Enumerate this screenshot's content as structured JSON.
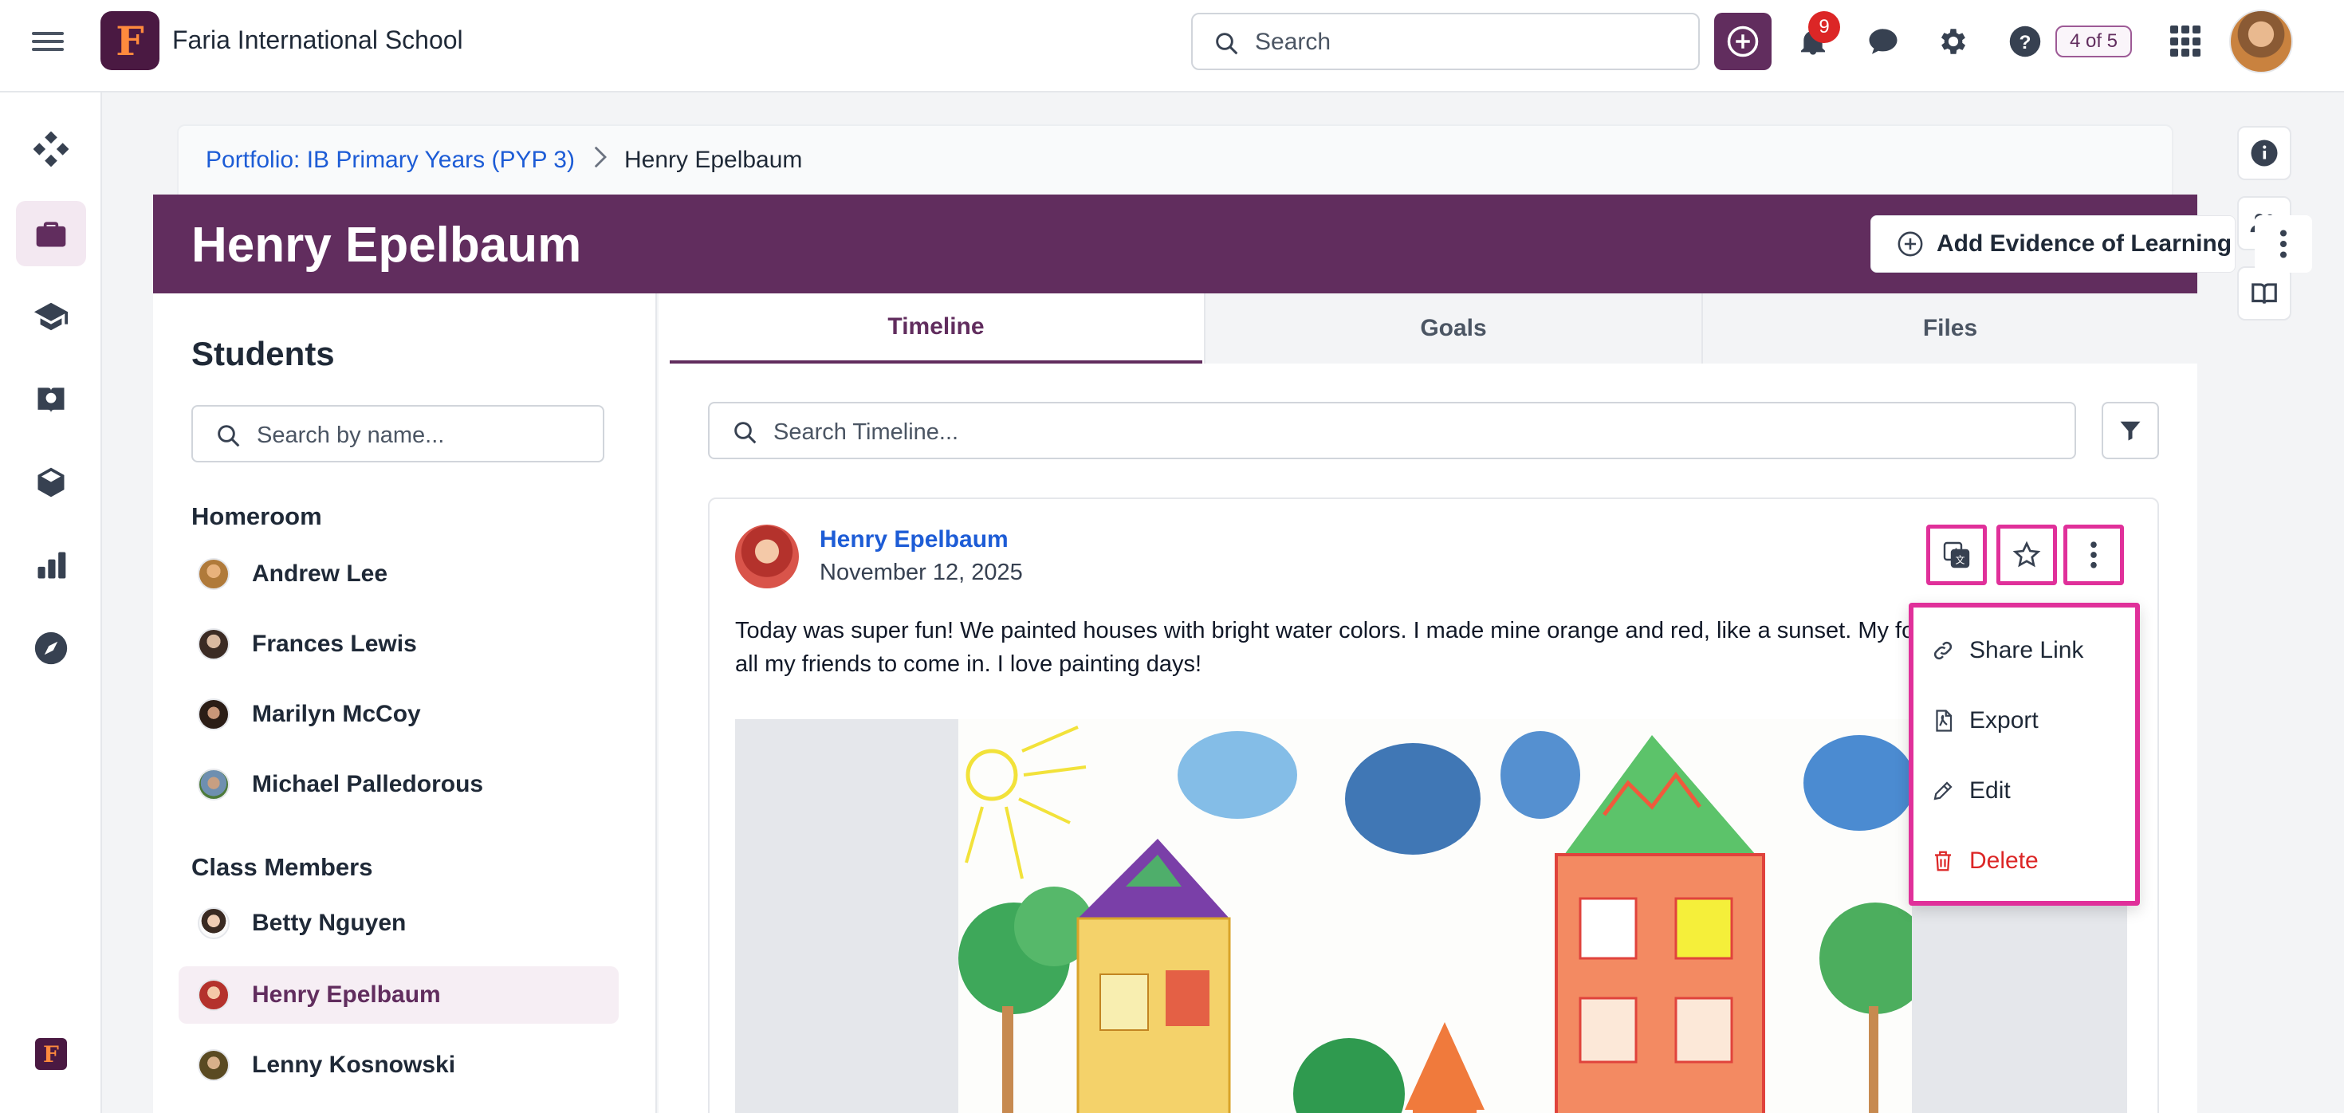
{
  "app": {
    "school_name": "Faria International School",
    "logo_letter": "F",
    "search_placeholder": "Search",
    "notification_count": "9",
    "pager": "4 of 5"
  },
  "breadcrumb": {
    "parent": "Portfolio: IB Primary Years (PYP 3)",
    "current": "Henry Epelbaum"
  },
  "header": {
    "title": "Henry Epelbaum",
    "add_evidence_label": "Add Evidence of Learning"
  },
  "students_panel": {
    "title": "Students",
    "search_placeholder": "Search by name...",
    "homeroom_label": "Homeroom",
    "homeroom": [
      {
        "name": "Andrew Lee"
      },
      {
        "name": "Frances Lewis"
      },
      {
        "name": "Marilyn McCoy"
      },
      {
        "name": "Michael Palledorous"
      }
    ],
    "class_members_label": "Class Members",
    "class_members": [
      {
        "name": "Betty Nguyen"
      },
      {
        "name": "Henry Epelbaum"
      },
      {
        "name": "Lenny Kosnowski"
      }
    ]
  },
  "tabs": [
    {
      "label": "Timeline"
    },
    {
      "label": "Goals"
    },
    {
      "label": "Files"
    }
  ],
  "timeline": {
    "search_placeholder": "Search Timeline...",
    "post": {
      "author": "Henry Epelbaum",
      "date": "November 12, 2025",
      "text": "Today was super fun! We painted houses with bright water colors. I made mine orange and red, like a sunset. My for all my friends to come in. I love painting days!"
    }
  },
  "menu": {
    "items": [
      {
        "label": "Share Link",
        "icon": "link-icon"
      },
      {
        "label": "Export",
        "icon": "pdf-icon"
      },
      {
        "label": "Edit",
        "icon": "pencil-icon"
      },
      {
        "label": "Delete",
        "icon": "trash-icon"
      }
    ]
  },
  "colors": {
    "brand_purple": "#612d5e",
    "link_blue": "#1d5cd6",
    "highlight_pink": "#e0309a",
    "danger_red": "#dc2626"
  }
}
